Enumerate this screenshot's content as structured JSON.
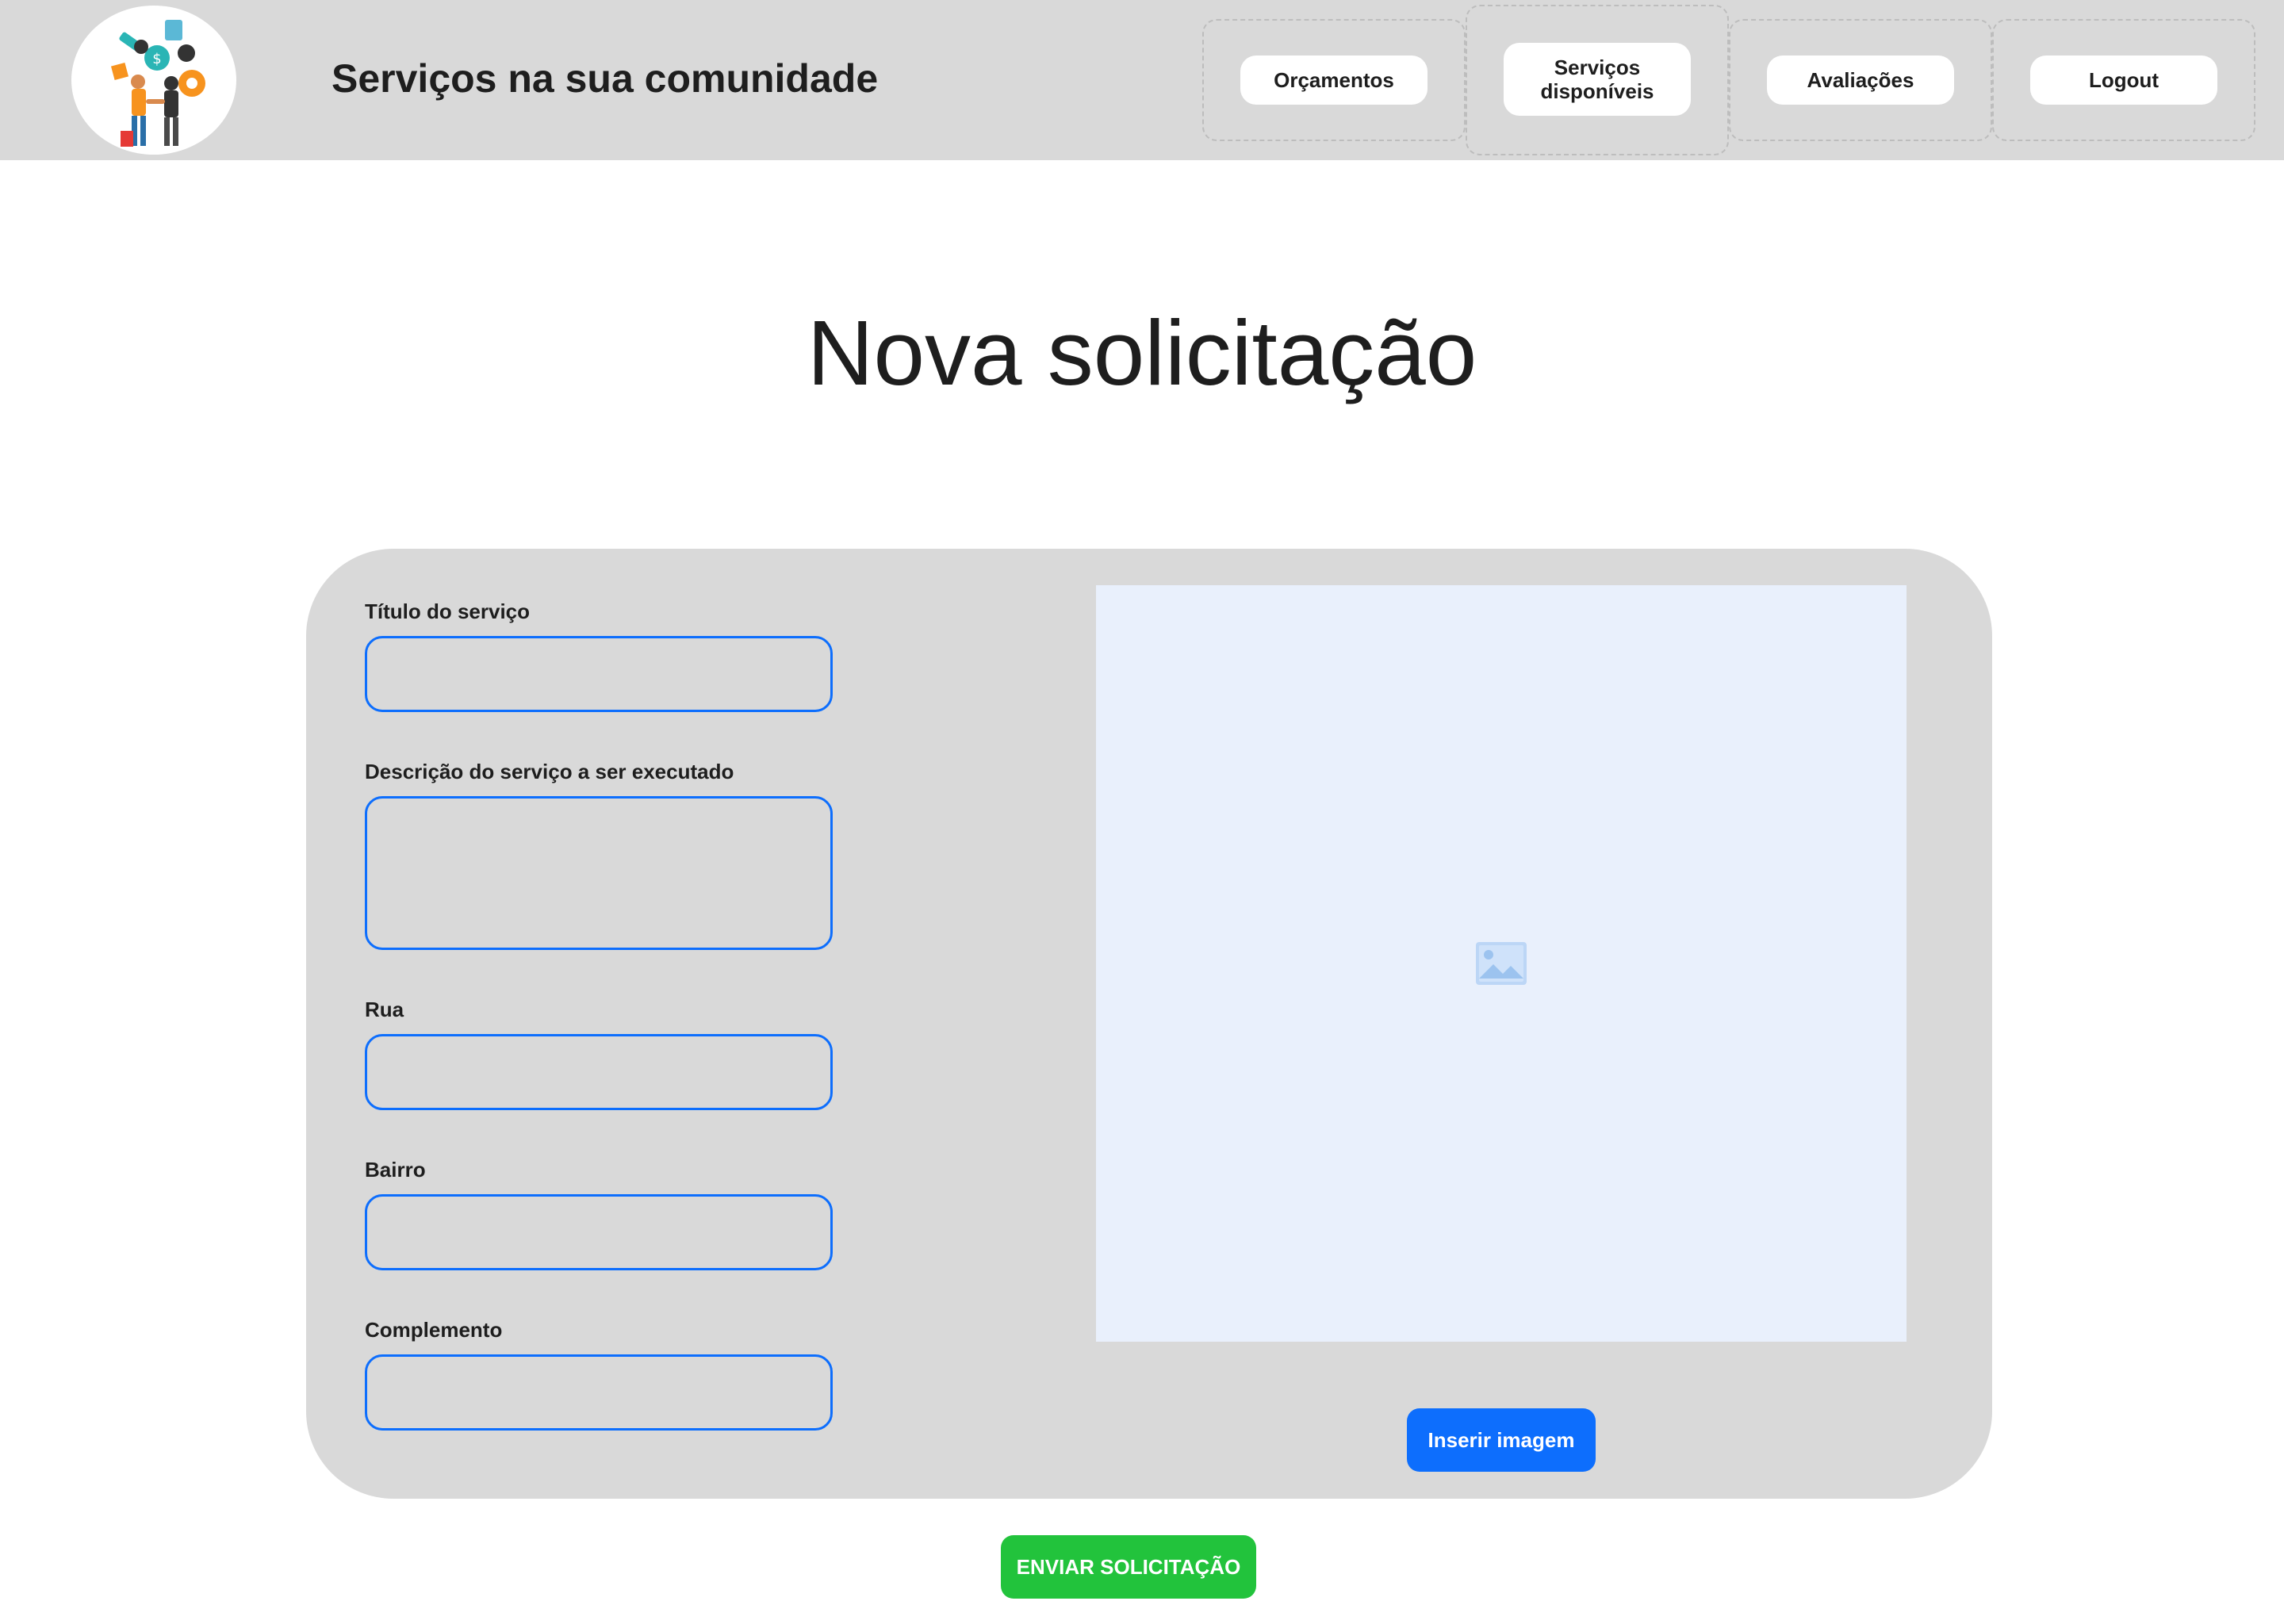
{
  "header": {
    "site_title": "Serviços na sua comunidade",
    "nav": [
      {
        "label": "Orçamentos"
      },
      {
        "label": "Serviços disponíveis"
      },
      {
        "label": "Avaliações"
      },
      {
        "label": "Logout"
      }
    ]
  },
  "page_title": "Nova solicitação",
  "form": {
    "fields": [
      {
        "label": "Título do serviço",
        "value": ""
      },
      {
        "label": "Descrição do serviço a ser executado",
        "value": ""
      },
      {
        "label": "Rua",
        "value": ""
      },
      {
        "label": "Bairro",
        "value": ""
      },
      {
        "label": "Complemento",
        "value": ""
      }
    ],
    "image_placeholder_icon": "image-icon",
    "insert_image_label": "Inserir imagem",
    "submit_label": "ENVIAR SOLICITAÇÃO"
  },
  "colors": {
    "header_bg": "#d9d9d9",
    "accent_blue": "#0d6efd",
    "submit_green": "#22c33c",
    "image_placeholder_bg": "#e9f0fc"
  }
}
